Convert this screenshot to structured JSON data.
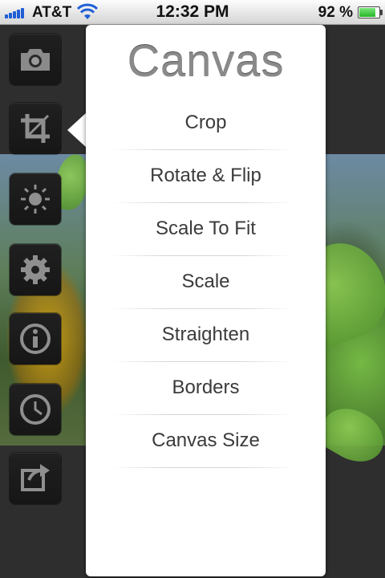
{
  "status_bar": {
    "carrier": "AT&T",
    "time": "12:32 PM",
    "battery_percent": "92",
    "battery_unit": "%",
    "battery_level": 0.92,
    "signal_icon": "signal-bars-icon",
    "wifi_icon": "wifi-icon",
    "battery_icon": "battery-icon"
  },
  "toolbar": {
    "items": [
      {
        "name": "camera",
        "icon": "camera-icon"
      },
      {
        "name": "canvas",
        "icon": "crop-icon",
        "selected": true
      },
      {
        "name": "adjust",
        "icon": "brightness-icon"
      },
      {
        "name": "effects",
        "icon": "gear-icon"
      },
      {
        "name": "info",
        "icon": "info-icon"
      },
      {
        "name": "history",
        "icon": "clock-icon"
      },
      {
        "name": "share",
        "icon": "share-icon"
      }
    ]
  },
  "popover": {
    "title": "Canvas",
    "items": [
      {
        "label": "Crop"
      },
      {
        "label": "Rotate & Flip"
      },
      {
        "label": "Scale To Fit"
      },
      {
        "label": "Scale"
      },
      {
        "label": "Straighten"
      },
      {
        "label": "Borders"
      },
      {
        "label": "Canvas Size"
      }
    ]
  },
  "colors": {
    "accent_blue": "#1f5fd6",
    "battery_green": "#27b527",
    "toolbar_bg": "#2e2e2e",
    "title_gray": "#8a8a8a"
  }
}
